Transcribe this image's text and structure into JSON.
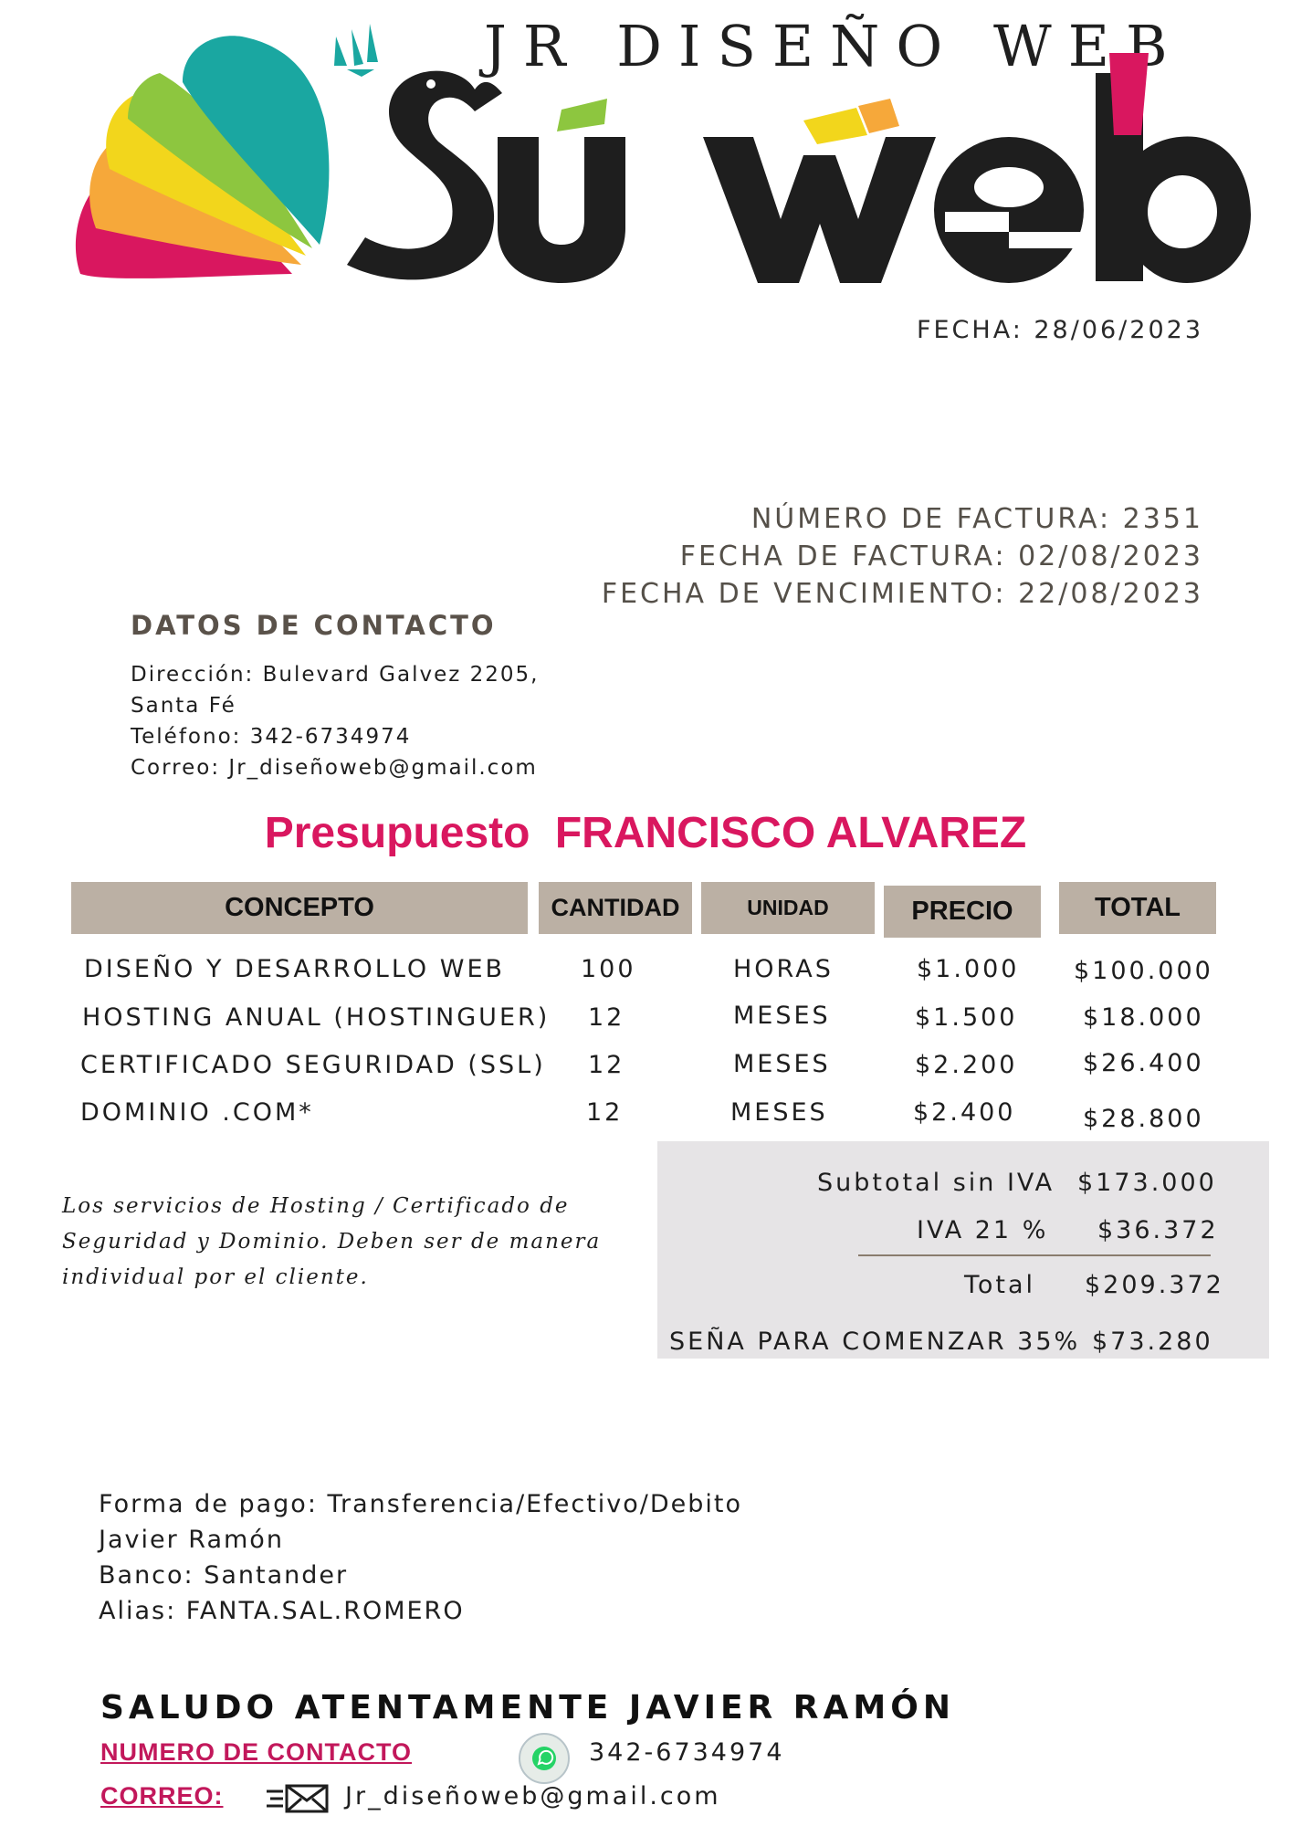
{
  "brand": {
    "top_text": "JR DISEÑO WEB",
    "logo_text": "Su web",
    "colors": {
      "magenta": "#d9175f",
      "teal": "#1aa7a1",
      "yellow": "#f2d61c",
      "orange": "#f6a83a",
      "green": "#8dc63f",
      "black": "#1e1e1e"
    }
  },
  "fecha": "FECHA: 28/06/2023",
  "invoice": {
    "numero": "NÚMERO DE FACTURA: 2351",
    "fecha_factura": "FECHA DE FACTURA: 02/08/2023",
    "vencimiento": "FECHA DE VENCIMIENTO: 22/08/2023"
  },
  "contact": {
    "title": "DATOS DE CONTACTO",
    "direccion_1": "Dirección: Bulevard Galvez 2205,",
    "direccion_2": "Santa Fé",
    "telefono": "Teléfono: 342-6734974",
    "correo": "Correo: Jr_diseñoweb@gmail.com"
  },
  "presupuesto": {
    "label": "Presupuesto",
    "cliente": "FRANCISCO ALVAREZ"
  },
  "table": {
    "headers": {
      "concepto": "CONCEPTO",
      "cantidad": "CANTIDAD",
      "unidad": "UNIDAD",
      "precio": "PRECIO",
      "total": "TOTAL"
    },
    "rows": [
      {
        "concepto": "DISEÑO Y DESARROLLO WEB",
        "cantidad": "100",
        "unidad": "HORAS",
        "precio": "$1.000",
        "total": "$100.000"
      },
      {
        "concepto": "HOSTING ANUAL (HOSTINGUER)",
        "cantidad": "12",
        "unidad": "MESES",
        "precio": "$1.500",
        "total": "$18.000"
      },
      {
        "concepto": "CERTIFICADO SEGURIDAD (SSL)",
        "cantidad": "12",
        "unidad": "MESES",
        "precio": "$2.200",
        "total": "$26.400"
      },
      {
        "concepto": "DOMINIO .COM*",
        "cantidad": "12",
        "unidad": "MESES",
        "precio": "$2.400",
        "total": "$28.800"
      }
    ]
  },
  "summary": {
    "subtotal_label": "Subtotal sin IVA",
    "subtotal": "$173.000",
    "iva_label": "IVA 21 %",
    "iva": "$36.372",
    "total_label": "Total",
    "total": "$209.372",
    "sena_label": "SEÑA PARA COMENZAR 35%",
    "sena": "$73.280"
  },
  "note": "Los servicios de  Hosting / Certificado de Seguridad y Dominio. Deben ser de manera individual por el cliente.",
  "payment": {
    "forma": "Forma de pago: Transferencia/Efectivo/Debito",
    "titular": "Javier Ramón",
    "banco": "Banco: Santander",
    "alias": "Alias: FANTA.SAL.ROMERO"
  },
  "footer": {
    "saludo": "SALUDO ATENTAMENTE JAVIER RAMÓN",
    "numero_label": "NUMERO DE  CONTACTO",
    "numero": "342-6734974",
    "correo_label": "CORREO:",
    "correo": "Jr_diseñoweb@gmail.com",
    "icons": [
      "whatsapp-icon",
      "mail-icon"
    ]
  }
}
